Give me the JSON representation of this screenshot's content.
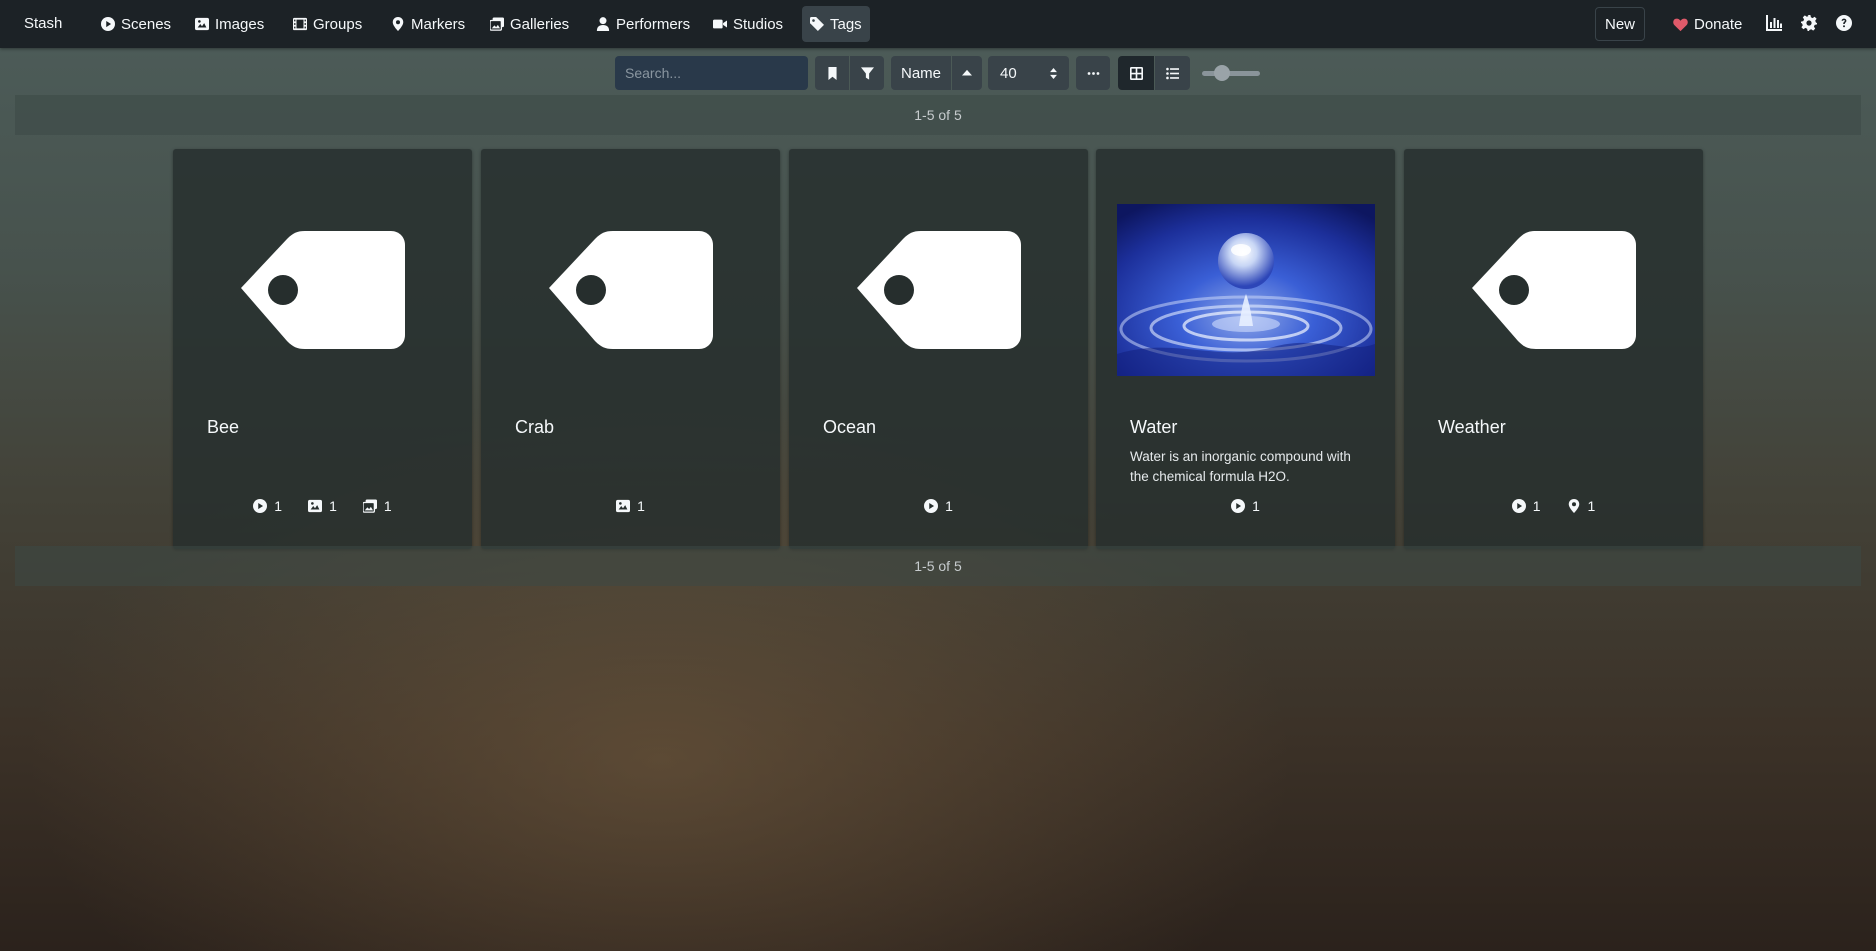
{
  "navbar": {
    "brand": "Stash",
    "items": [
      {
        "label": "Scenes",
        "icon": "play-circle-icon"
      },
      {
        "label": "Images",
        "icon": "image-icon"
      },
      {
        "label": "Groups",
        "icon": "film-icon"
      },
      {
        "label": "Markers",
        "icon": "map-marker-icon"
      },
      {
        "label": "Galleries",
        "icon": "images-icon"
      },
      {
        "label": "Performers",
        "icon": "user-icon"
      },
      {
        "label": "Studios",
        "icon": "video-icon"
      },
      {
        "label": "Tags",
        "icon": "tag-icon",
        "active": true
      }
    ],
    "new_label": "New",
    "donate_label": "Donate",
    "icons": [
      "chart-icon",
      "gear-icon",
      "help-icon"
    ]
  },
  "toolbar": {
    "search_placeholder": "Search...",
    "sort_label": "Name",
    "per_page": "40",
    "zoom_level": 0.25
  },
  "pagination": {
    "top": "1-5 of 5",
    "bottom": "1-5 of 5"
  },
  "colors": {
    "navbar_bg": "#1c2226",
    "active_nav": "#394349",
    "heart": "#e05a6a",
    "card_bg": "#262e2d"
  },
  "cards": [
    {
      "title": "Bee",
      "description": "",
      "counts": {
        "scenes": "1",
        "images": "1",
        "galleries": "1"
      }
    },
    {
      "title": "Crab",
      "description": "",
      "counts": {
        "images": "1"
      }
    },
    {
      "title": "Ocean",
      "description": "",
      "counts": {
        "scenes": "1"
      }
    },
    {
      "title": "Water",
      "description": "Water is an inorganic compound with the chemical formula H2O.",
      "counts": {
        "scenes": "1"
      }
    },
    {
      "title": "Weather",
      "description": "",
      "counts": {
        "scenes": "1",
        "markers": "1"
      }
    }
  ]
}
